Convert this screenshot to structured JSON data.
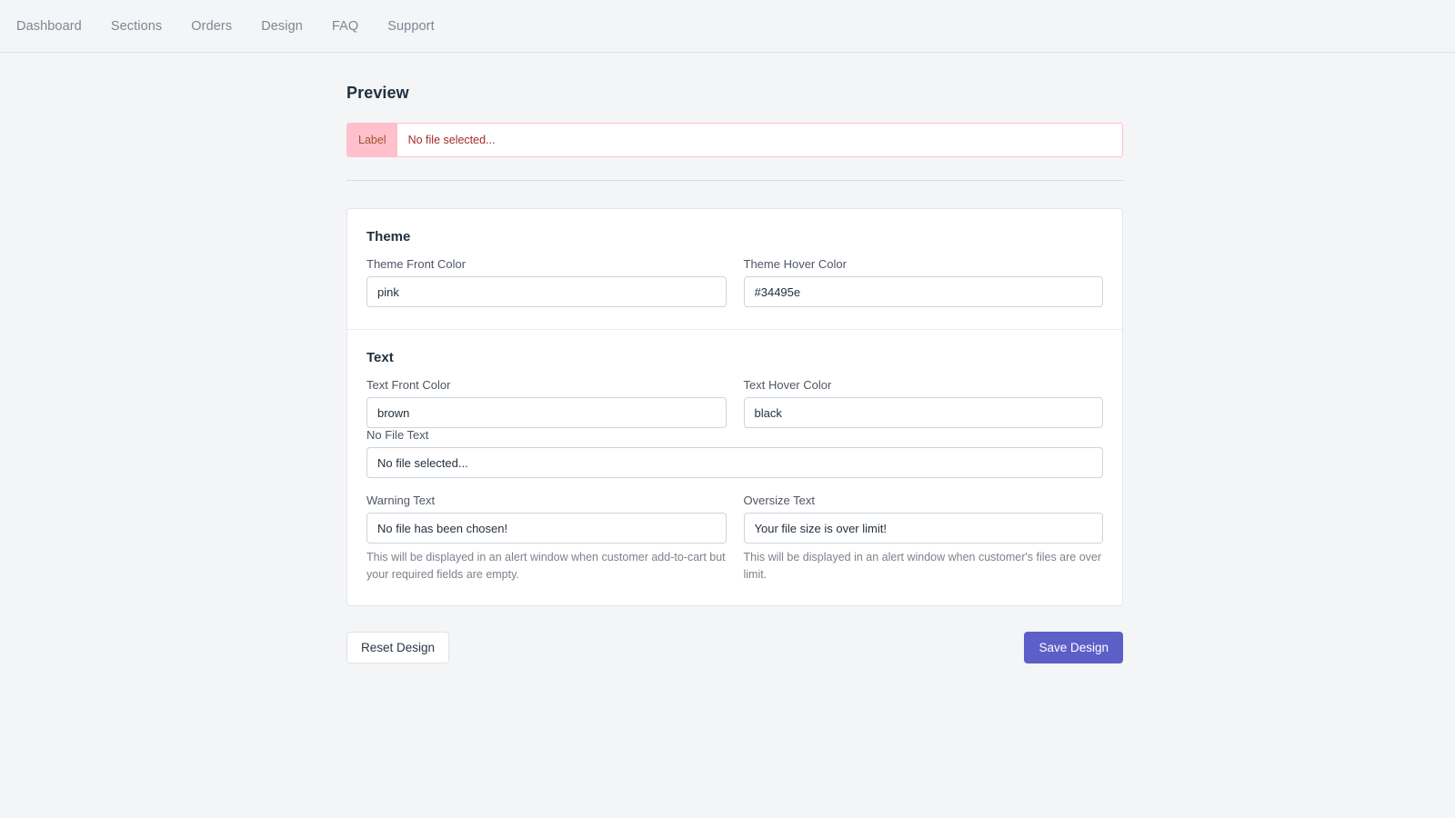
{
  "nav": {
    "items": [
      {
        "label": "Dashboard"
      },
      {
        "label": "Sections"
      },
      {
        "label": "Orders"
      },
      {
        "label": "Design"
      },
      {
        "label": "FAQ"
      },
      {
        "label": "Support"
      }
    ]
  },
  "preview": {
    "title": "Preview",
    "file_input": {
      "button_label": "Label",
      "filename_text": "No file selected...",
      "border_color": "#ffc0cb",
      "button_bg": "#ffc0cb",
      "text_color": "#a52a2a"
    }
  },
  "theme_section": {
    "title": "Theme",
    "front_color": {
      "label": "Theme Front Color",
      "value": "pink"
    },
    "hover_color": {
      "label": "Theme Hover Color",
      "value": "#34495e"
    }
  },
  "text_section": {
    "title": "Text",
    "front_color": {
      "label": "Text Front Color",
      "value": "brown"
    },
    "hover_color": {
      "label": "Text Hover Color",
      "value": "black"
    },
    "no_file_text": {
      "label": "No File Text",
      "value": "No file selected..."
    },
    "warning_text": {
      "label": "Warning Text",
      "value": "No file has been chosen!",
      "help": "This will be displayed in an alert window when customer add-to-cart but your required fields are empty."
    },
    "oversize_text": {
      "label": "Oversize Text",
      "value": "Your file size is over limit!",
      "help": "This will be displayed in an alert window when customer's files are over limit."
    }
  },
  "actions": {
    "reset_label": "Reset Design",
    "save_label": "Save Design",
    "save_color": "#5b5fc7"
  }
}
